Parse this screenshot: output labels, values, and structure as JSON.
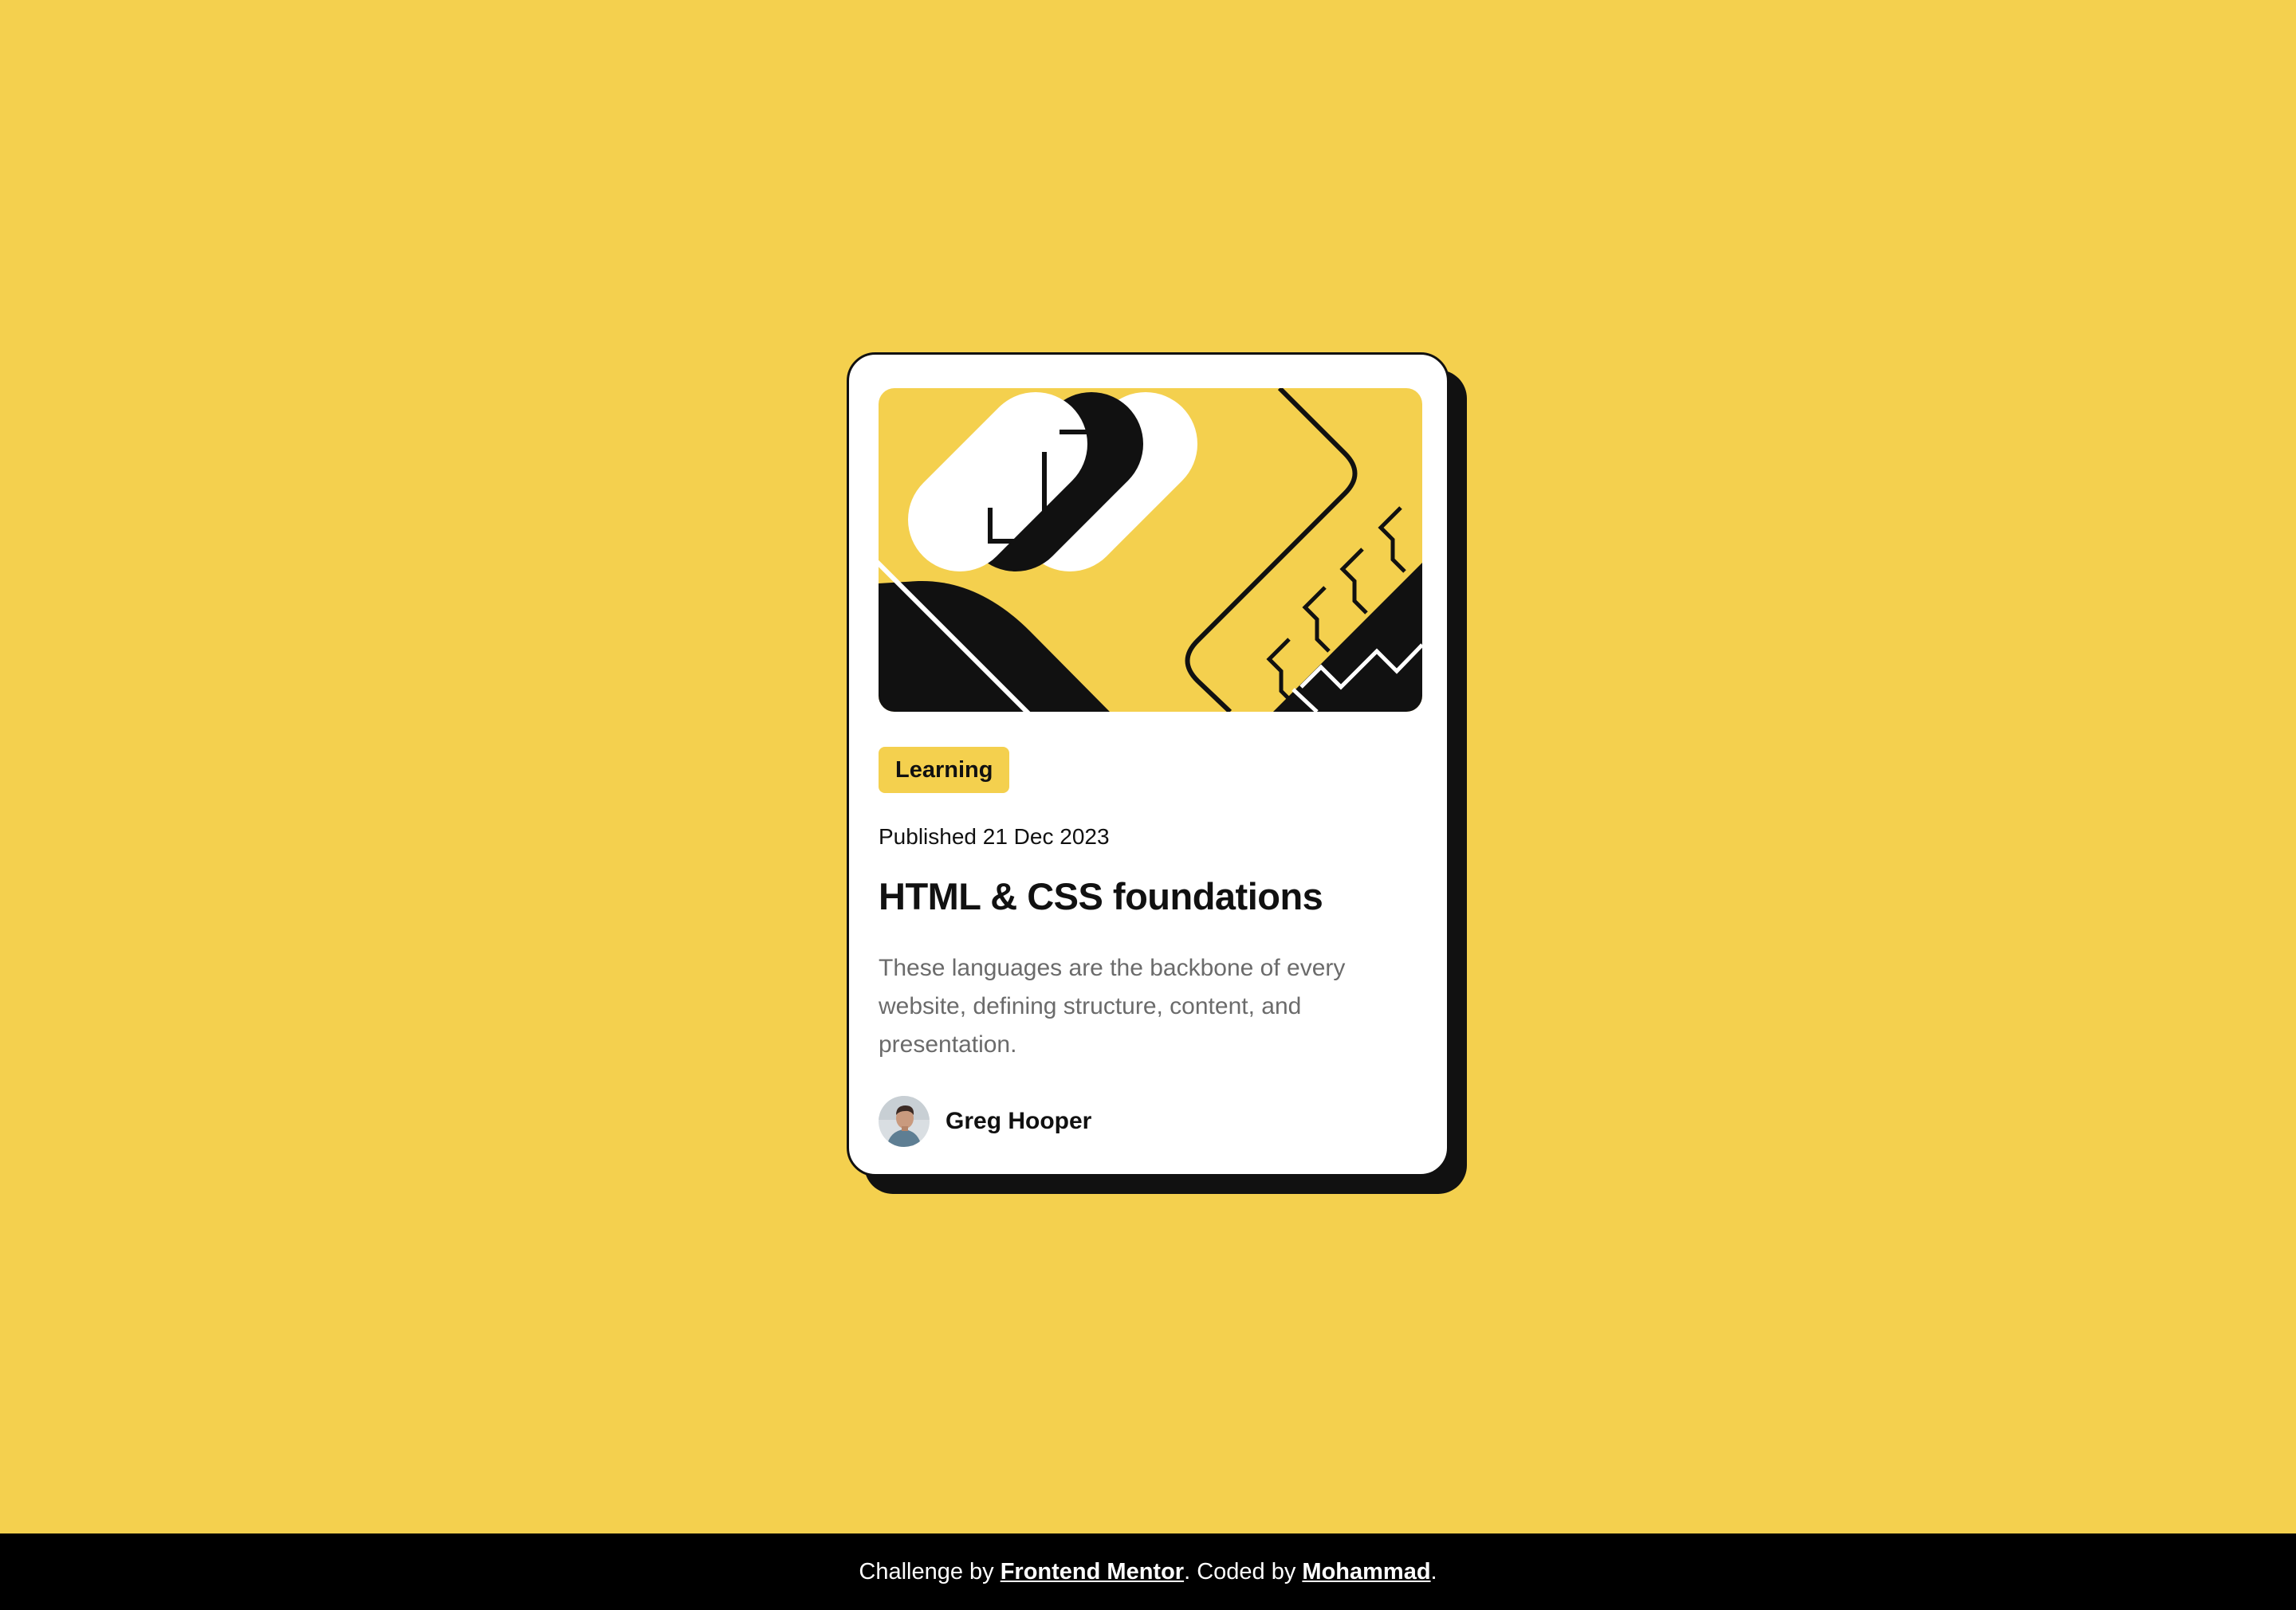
{
  "colors": {
    "background": "#F4D04E",
    "card": "#FFFFFF",
    "ink": "#111111",
    "muted": "#6B6B6B",
    "footer": "#000000"
  },
  "card": {
    "illustration": "abstract-code-illustration",
    "tag": "Learning",
    "published": "Published 21 Dec 2023",
    "title": "HTML & CSS foundations",
    "description": "These languages are the backbone of every website, defining structure, content, and presentation.",
    "author": {
      "avatar": "avatar-photo",
      "name": "Greg Hooper"
    }
  },
  "footer": {
    "prefix": "Challenge by ",
    "link1": "Frontend Mentor",
    "middle": ". Coded by ",
    "link2": "Mohammad",
    "suffix": "."
  }
}
